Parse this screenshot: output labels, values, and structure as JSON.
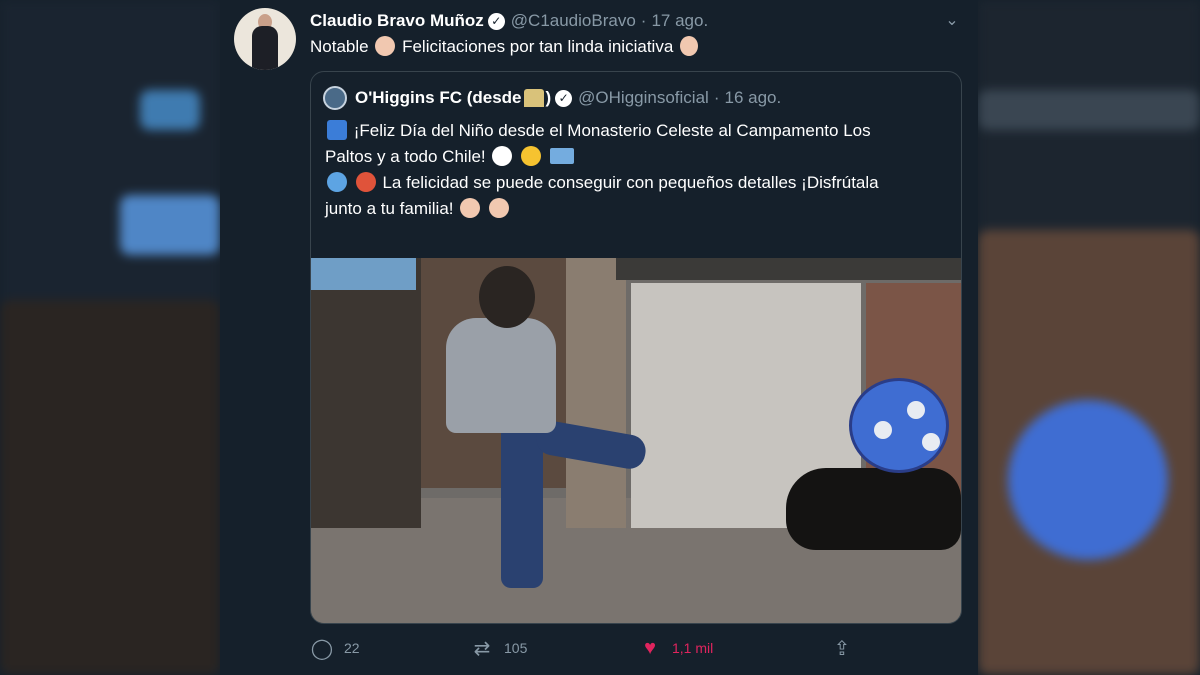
{
  "tweet": {
    "author_name": "Claudio Bravo Muñoz",
    "author_handle": "@C1audioBravo",
    "separator": "·",
    "date": "17 ago.",
    "text_before": "Notable",
    "text_after": "Felicitaciones por tan linda iniciativa",
    "more_icon": "chevron-down"
  },
  "quote": {
    "author_name": "O'Higgins FC (desde",
    "author_name_close": ")",
    "author_handle": "@OHigginsoficial",
    "separator": "·",
    "date": "16 ago.",
    "line1": "¡Feliz Día del Niño desde el Monasterio Celeste al Campamento Los",
    "line2": "Paltos y a todo Chile!",
    "line3": "La felicidad se puede conseguir con pequeños detalles ¡Disfrútala",
    "line4": "junto a tu familia!",
    "media": "video-thumbnail"
  },
  "actions": {
    "reply_count": "22",
    "retweet_count": "105",
    "like_count": "1,1 mil"
  },
  "colors": {
    "background": "#15202b",
    "text": "#ffffff",
    "muted": "#8899a6",
    "border": "#38444d",
    "like": "#e0245e"
  }
}
